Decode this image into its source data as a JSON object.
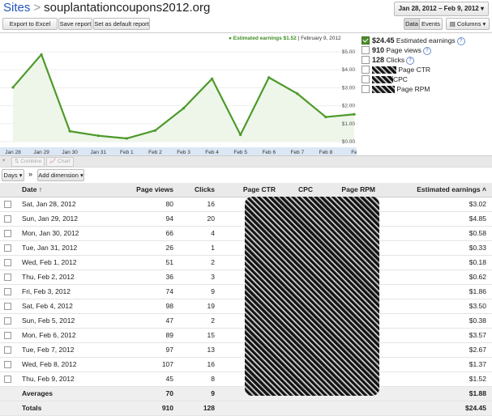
{
  "header": {
    "breadcrumb_link": "Sites",
    "breadcrumb_sep": ">",
    "site_title": "souplantationcoupons2012.org",
    "date_range": "Jan 28, 2012 – Feb 9, 2012 ▾"
  },
  "toolbar": {
    "export_csv": "Export to Excel CSV",
    "save_report": "Save report",
    "set_default": "Set as default report",
    "data_tab": "Data",
    "events_tab": "Events",
    "columns": "Columns ▾"
  },
  "chart_tooltip": {
    "series": "● Estimated earnings $1.52",
    "date": "| February 9, 2012"
  },
  "legend": {
    "earnings_value": "$24.45",
    "earnings_label": "Estimated earnings",
    "pageviews_value": "910",
    "pageviews_label": "Page views",
    "clicks_value": "128",
    "clicks_label": "Clicks",
    "ctr_label": "Page CTR",
    "cpc_label": "CPC",
    "rpm_label": "Page RPM"
  },
  "toolbar2": {
    "combine": "Combine",
    "chart": "Chart"
  },
  "toolbar3": {
    "days": "Days ▾",
    "sep": "»",
    "add_dimension": "Add dimension ▾"
  },
  "table": {
    "headers": {
      "date": "Date ↑",
      "pageviews": "Page views",
      "clicks": "Clicks",
      "ctr": "Page CTR",
      "cpc": "CPC",
      "rpm": "Page RPM",
      "earnings": "Estimated earnings ˄"
    },
    "rows": [
      {
        "date": "Sat, Jan 28, 2012",
        "pageviews": "80",
        "clicks": "16",
        "earnings": "$3.02"
      },
      {
        "date": "Sun, Jan 29, 2012",
        "pageviews": "94",
        "clicks": "20",
        "earnings": "$4.85"
      },
      {
        "date": "Mon, Jan 30, 2012",
        "pageviews": "66",
        "clicks": "4",
        "earnings": "$0.58"
      },
      {
        "date": "Tue, Jan 31, 2012",
        "pageviews": "26",
        "clicks": "1",
        "earnings": "$0.33"
      },
      {
        "date": "Wed, Feb 1, 2012",
        "pageviews": "51",
        "clicks": "2",
        "earnings": "$0.18"
      },
      {
        "date": "Thu, Feb 2, 2012",
        "pageviews": "36",
        "clicks": "3",
        "earnings": "$0.62"
      },
      {
        "date": "Fri, Feb 3, 2012",
        "pageviews": "74",
        "clicks": "9",
        "earnings": "$1.86"
      },
      {
        "date": "Sat, Feb 4, 2012",
        "pageviews": "98",
        "clicks": "19",
        "earnings": "$3.50"
      },
      {
        "date": "Sun, Feb 5, 2012",
        "pageviews": "47",
        "clicks": "2",
        "earnings": "$0.38"
      },
      {
        "date": "Mon, Feb 6, 2012",
        "pageviews": "89",
        "clicks": "15",
        "earnings": "$3.57"
      },
      {
        "date": "Tue, Feb 7, 2012",
        "pageviews": "97",
        "clicks": "13",
        "earnings": "$2.67"
      },
      {
        "date": "Wed, Feb 8, 2012",
        "pageviews": "107",
        "clicks": "16",
        "earnings": "$1.37"
      },
      {
        "date": "Thu, Feb 9, 2012",
        "pageviews": "45",
        "clicks": "8",
        "earnings": "$1.52"
      }
    ],
    "averages": {
      "label": "Averages",
      "pageviews": "70",
      "clicks": "9",
      "earnings": "$1.88"
    },
    "totals": {
      "label": "Totals",
      "pageviews": "910",
      "clicks": "128",
      "earnings": "$24.45"
    }
  },
  "colors": {
    "line": "#4d9a2a",
    "area": "#eef6ea",
    "link": "#2255bb"
  },
  "chart_data": {
    "type": "area",
    "categories": [
      "Jan 28",
      "Jan 29",
      "Jan 30",
      "Jan 31",
      "Feb 1",
      "Feb 2",
      "Feb 3",
      "Feb 4",
      "Feb 5",
      "Feb 6",
      "Feb 7",
      "Feb 8",
      "Feb 9"
    ],
    "x_tick_labels": [
      "Jan 28",
      "Jan 29",
      "Jan 30",
      "Jan 31",
      "Feb 1",
      "Feb 2",
      "Feb 3",
      "Feb 4",
      "Feb 5",
      "Feb 6",
      "Feb 7",
      "Feb 8",
      "Fe"
    ],
    "series": [
      {
        "name": "Estimated earnings",
        "values": [
          3.02,
          4.85,
          0.58,
          0.33,
          0.18,
          0.62,
          1.86,
          3.5,
          0.38,
          3.57,
          2.67,
          1.37,
          1.52
        ]
      }
    ],
    "y_ticks": [
      "$5.00",
      "$4.00",
      "$3.00",
      "$2.00",
      "$1.00",
      "$0.00"
    ],
    "ylim": [
      0,
      5
    ]
  }
}
